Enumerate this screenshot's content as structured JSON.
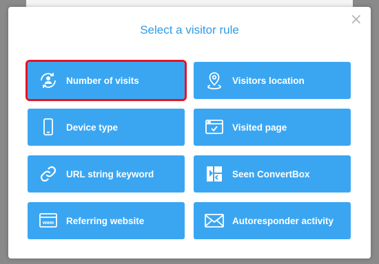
{
  "modal": {
    "title": "Select a visitor rule",
    "close_symbol": "×"
  },
  "rules": [
    {
      "label": "Number of visits",
      "icon": "visitors-cycle-icon",
      "selected": true
    },
    {
      "label": "Visitors location",
      "icon": "location-pin-icon",
      "selected": false
    },
    {
      "label": "Device type",
      "icon": "mobile-phone-icon",
      "selected": false
    },
    {
      "label": "Visited page",
      "icon": "browser-check-icon",
      "selected": false
    },
    {
      "label": "URL string keyword",
      "icon": "link-icon",
      "selected": false
    },
    {
      "label": "Seen ConvertBox",
      "icon": "convertbox-logo-icon",
      "selected": false
    },
    {
      "label": "Referring website",
      "icon": "www-browser-icon",
      "selected": false
    },
    {
      "label": "Autoresponder activity",
      "icon": "envelope-icon",
      "selected": false
    }
  ],
  "colors": {
    "tile": "#3aa6f2",
    "title": "#2f9be6",
    "selected_outline": "#e8131f"
  }
}
